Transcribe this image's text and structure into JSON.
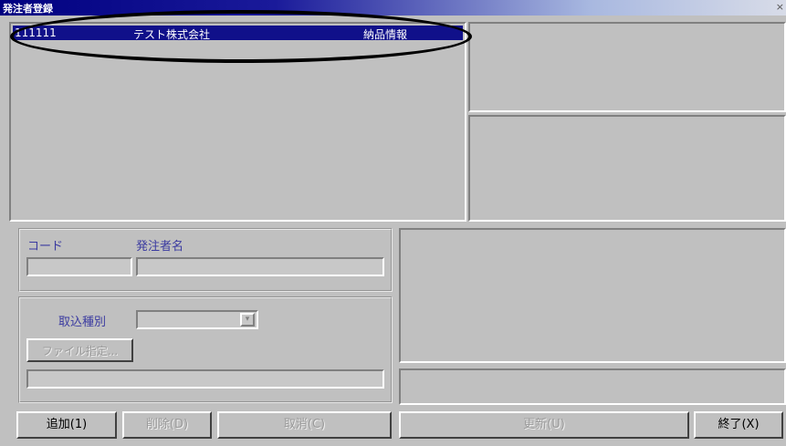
{
  "window": {
    "title": "発注者登録",
    "close_glyph": "×"
  },
  "list": {
    "rows": [
      {
        "code": "111111",
        "name": "テスト株式会社",
        "type": "納品情報"
      }
    ]
  },
  "form": {
    "code_label": "コード",
    "name_label": "発注者名",
    "code_value": "",
    "name_value": "",
    "import_type_label": "取込種別",
    "import_type_value": "",
    "dropdown_glyph": "▾",
    "specify_button": "ファイル指定...",
    "path_value": ""
  },
  "buttons": {
    "add": "追加(1)",
    "delete": "削除(D)",
    "cancel": "取消(C)",
    "update": "更新(U)",
    "exit": "終了(X)"
  }
}
